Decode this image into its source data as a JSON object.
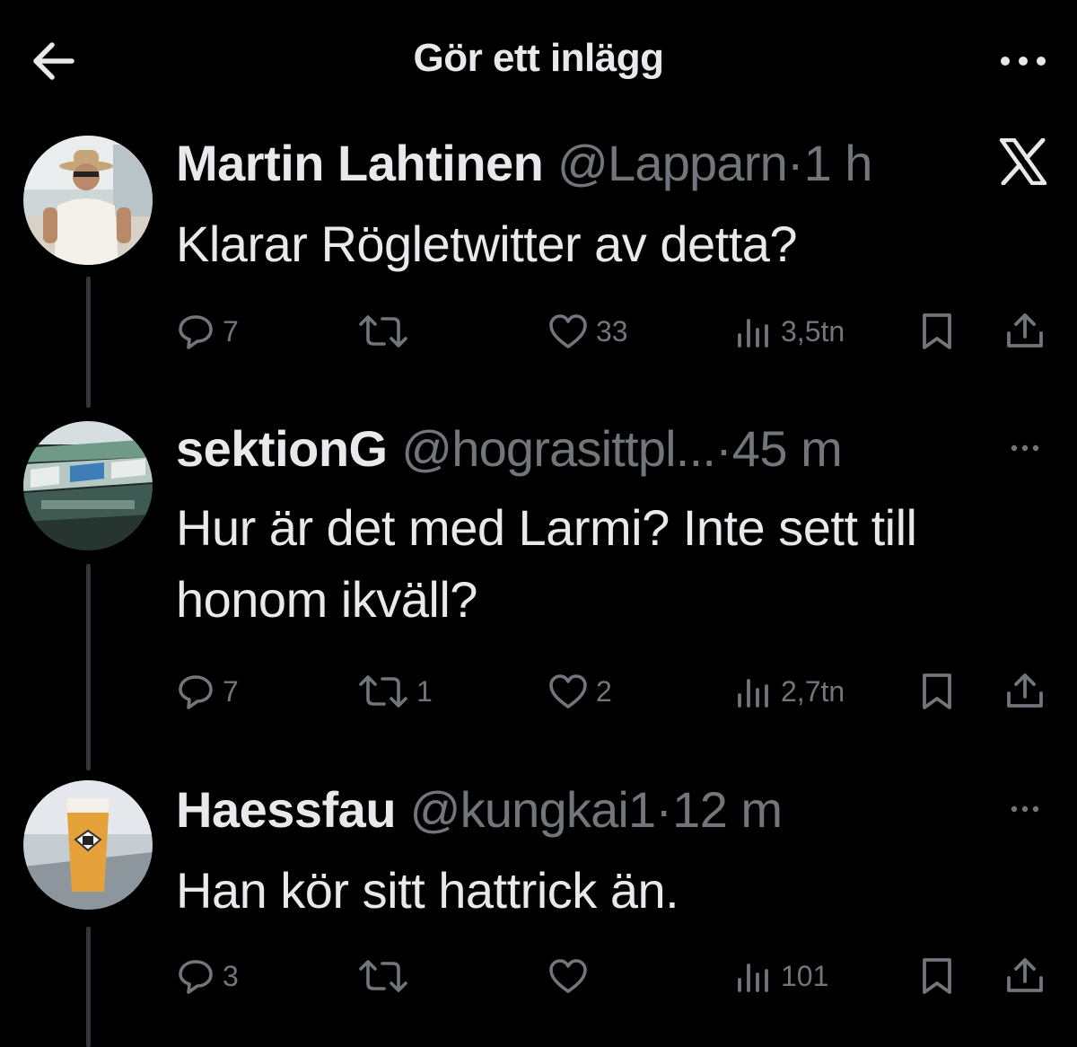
{
  "header": {
    "title": "Gör ett inlägg"
  },
  "tweets": [
    {
      "name": "Martin Lahtinen",
      "handle": "@Lapparn",
      "separator": "·",
      "time": "1 h",
      "text": "Klarar Rögletwitter av detta?",
      "replies": "7",
      "reposts": "",
      "likes": "33",
      "views": "3,5tn"
    },
    {
      "name": "sektionG",
      "handle": "@hograsittpl...",
      "separator": "·",
      "time": "45 m",
      "text": "Hur är det med Larmi? Inte sett till honom ikväll?",
      "replies": "7",
      "reposts": "1",
      "likes": "2",
      "views": "2,7tn"
    },
    {
      "name": "Haessfau",
      "handle": "@kungkai1",
      "separator": "·",
      "time": "12 m",
      "text": "Han kör sitt hattrick än.",
      "replies": "3",
      "reposts": "",
      "likes": "",
      "views": "101"
    }
  ],
  "colors": {
    "background": "#000000",
    "text_primary": "#e7e9ea",
    "text_secondary": "#71767b",
    "thread_line": "#333639"
  },
  "icons": {
    "back": "arrow-left-icon",
    "more": "more-horizontal-icon",
    "brand": "x-logo-icon",
    "reply": "reply-bubble-icon",
    "repost": "repost-icon",
    "like": "heart-icon",
    "views": "views-chart-icon",
    "bookmark": "bookmark-icon",
    "share": "share-icon"
  }
}
